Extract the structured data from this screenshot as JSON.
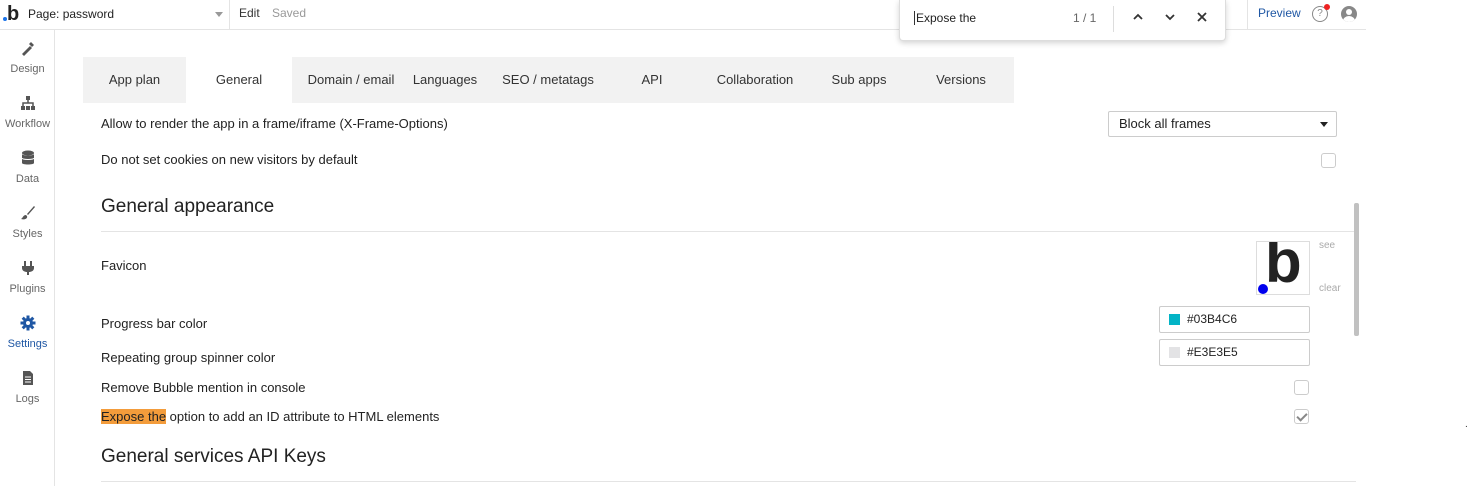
{
  "topbar": {
    "page_label": "Page: password",
    "edit_label": "Edit",
    "saved_label": "Saved",
    "preview_label": "Preview"
  },
  "find": {
    "query": "Expose the",
    "count": "1 / 1"
  },
  "sidebar": {
    "items": [
      {
        "label": "Design",
        "icon": "design-icon"
      },
      {
        "label": "Workflow",
        "icon": "workflow-icon"
      },
      {
        "label": "Data",
        "icon": "database-icon"
      },
      {
        "label": "Styles",
        "icon": "brush-icon"
      },
      {
        "label": "Plugins",
        "icon": "plug-icon"
      },
      {
        "label": "Settings",
        "icon": "gear-icon",
        "active": true
      },
      {
        "label": "Logs",
        "icon": "document-icon"
      }
    ]
  },
  "tabs": [
    {
      "label": "App plan"
    },
    {
      "label": "General",
      "active": true
    },
    {
      "label": "Domain / email"
    },
    {
      "label": "Languages"
    },
    {
      "label": "SEO / metatags"
    },
    {
      "label": "API"
    },
    {
      "label": "Collaboration"
    },
    {
      "label": "Sub apps"
    },
    {
      "label": "Versions"
    }
  ],
  "settings": {
    "iframe_label": "Allow to render the app in a frame/iframe (X-Frame-Options)",
    "iframe_value": "Block all frames",
    "cookies_label": "Do not set cookies on new visitors by default",
    "cookies_checked": false,
    "appearance_title": "General appearance",
    "favicon_label": "Favicon",
    "favicon_see": "see",
    "favicon_clear": "clear",
    "progress_label": "Progress bar color",
    "progress_color": "#03B4C6",
    "spinner_label": "Repeating group spinner color",
    "spinner_color": "#E3E3E5",
    "mention_label": "Remove Bubble mention in console",
    "mention_checked": false,
    "expose_highlight": "Expose the",
    "expose_rest": " option to add an ID attribute to HTML elements",
    "expose_checked": true,
    "api_keys_title": "General services API Keys"
  },
  "colors": {
    "accent": "#1f57a4",
    "highlight": "#f39c3b"
  }
}
